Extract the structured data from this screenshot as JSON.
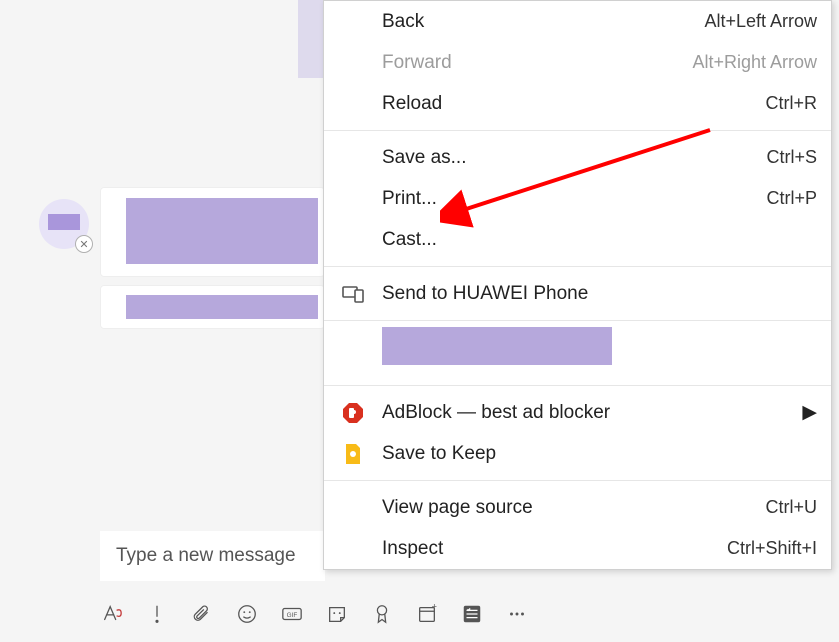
{
  "chat": {
    "compose_placeholder": "Type a new message"
  },
  "toolbar": {
    "items": [
      "format",
      "priority",
      "attach",
      "emoji",
      "gif",
      "sticker",
      "praise",
      "schedule",
      "tasks",
      "more"
    ]
  },
  "context_menu": {
    "back": {
      "label": "Back",
      "shortcut": "Alt+Left Arrow"
    },
    "forward": {
      "label": "Forward",
      "shortcut": "Alt+Right Arrow"
    },
    "reload": {
      "label": "Reload",
      "shortcut": "Ctrl+R"
    },
    "save_as": {
      "label": "Save as...",
      "shortcut": "Ctrl+S"
    },
    "print": {
      "label": "Print...",
      "shortcut": "Ctrl+P"
    },
    "cast": {
      "label": "Cast...",
      "shortcut": ""
    },
    "send_to": {
      "label": "Send to HUAWEI Phone",
      "shortcut": ""
    },
    "adblock": {
      "label": "AdBlock — best ad blocker",
      "shortcut": ""
    },
    "save_to_keep": {
      "label": "Save to Keep",
      "shortcut": ""
    },
    "view_source": {
      "label": "View page source",
      "shortcut": "Ctrl+U"
    },
    "inspect": {
      "label": "Inspect",
      "shortcut": "Ctrl+Shift+I"
    }
  },
  "colors": {
    "redaction": "#b6a8dc",
    "annotation_arrow": "#ff0000"
  }
}
